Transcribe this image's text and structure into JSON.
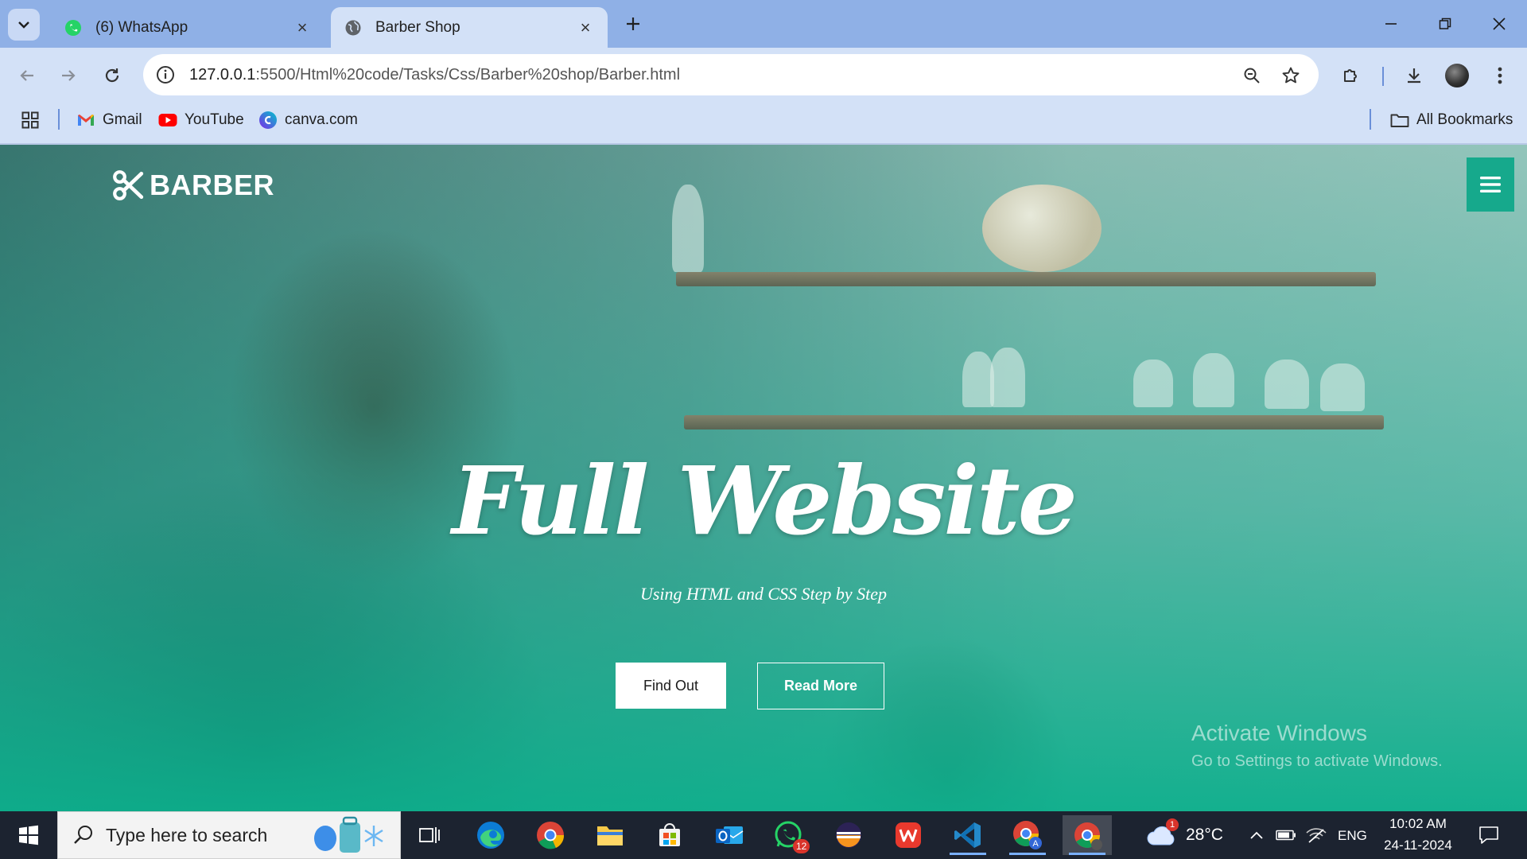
{
  "browser": {
    "tabs": [
      {
        "title": "(6) WhatsApp",
        "active": false
      },
      {
        "title": "Barber Shop",
        "active": true
      }
    ],
    "url_host": "127.0.0.1",
    "url_path": ":5500/Html%20code/Tasks/Css/Barber%20shop/Barber.html",
    "bookmarks": [
      "Gmail",
      "YouTube",
      "canva.com"
    ],
    "all_bookmarks": "All Bookmarks"
  },
  "site": {
    "logo_text": "BARBER",
    "hero_title": "Full Website",
    "hero_subtitle": "Using HTML and CSS Step by Step",
    "btn_find": "Find Out",
    "btn_read": "Read More",
    "accent_color": "#16a98c"
  },
  "watermark": {
    "line1": "Activate Windows",
    "line2": "Go to Settings to activate Windows."
  },
  "taskbar": {
    "search_placeholder": "Type here to search",
    "weather_temp": "28°C",
    "weather_badge": "1",
    "whatsapp_badge": "12",
    "language": "ENG",
    "time": "10:02 AM",
    "date": "24-11-2024"
  }
}
